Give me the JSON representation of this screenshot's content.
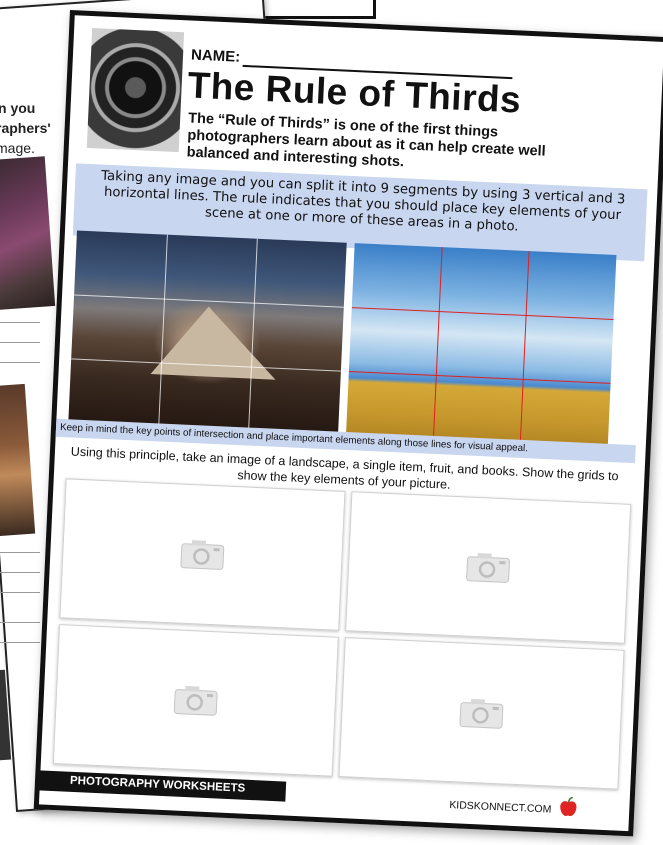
{
  "back_sheet": {
    "lines": [
      "n you",
      "raphers'",
      "mage."
    ]
  },
  "worksheet": {
    "name_label": "NAME:",
    "title": "The Rule of Thirds",
    "intro": "The “Rule of Thirds” is one of the first things photographers learn about as it can help create well balanced and interesting shots.",
    "explanation": "Taking any image and you can split it into 9 segments by using 3 vertical and 3 horizontal lines. The rule indicates that you should place key elements of your scene at one or more of these areas in a photo.",
    "tip": "Keep in mind the key points of intersection and place important elements along those lines for visual appeal.",
    "instruction": "Using this principle, take an image of a landscape, a single item, fruit, and books. Show the grids to show the key elements of your picture.",
    "photos": [
      {
        "subject": "mountain",
        "grid_color": "#ffffff"
      },
      {
        "subject": "wheat-field-sky",
        "grid_color": "#e02020"
      }
    ],
    "upload_boxes": [
      {
        "icon": "camera-icon"
      },
      {
        "icon": "camera-icon"
      },
      {
        "icon": "camera-icon"
      },
      {
        "icon": "camera-icon"
      }
    ],
    "footer_label": "PHOTOGRAPHY WORKSHEETS",
    "site": "KIDSKONNECT.COM",
    "accent_color": "#c9d6ef"
  }
}
